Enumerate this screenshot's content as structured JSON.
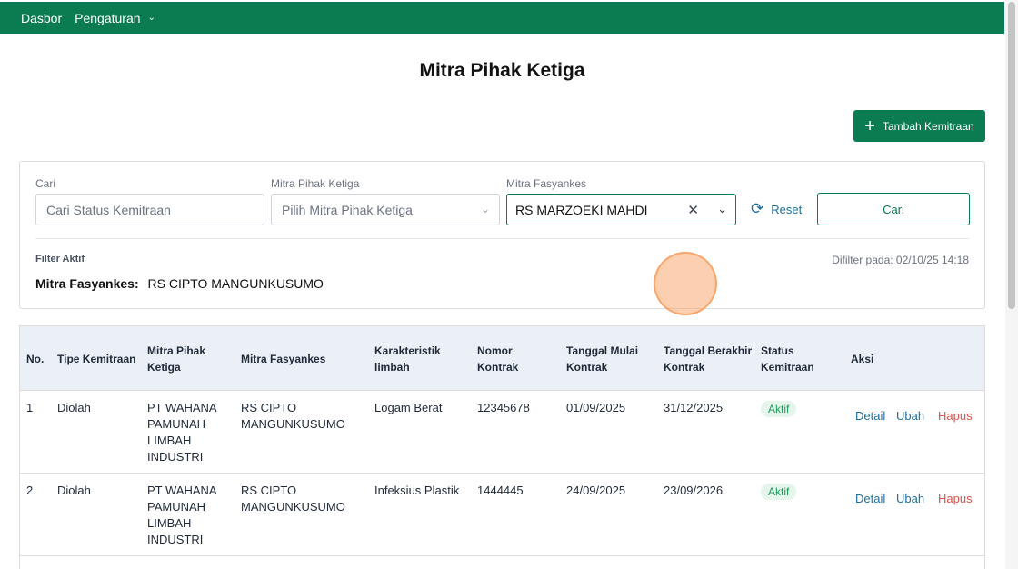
{
  "nav": {
    "items": [
      "Dasbor",
      "Pengaturan"
    ]
  },
  "page": {
    "title": "Mitra Pihak Ketiga",
    "add_button": "Tambah Kemitraan"
  },
  "filters": {
    "search": {
      "label": "Cari",
      "placeholder": "Cari Status Kemitraan"
    },
    "partner": {
      "label": "Mitra Pihak Ketiga",
      "placeholder": "Pilih Mitra Pihak Ketiga"
    },
    "facility": {
      "label": "Mitra Fasyankes",
      "value": "RS MARZOEKI MAHDI"
    },
    "reset_label": "Reset",
    "search_button": "Cari",
    "active_label": "Filter Aktif",
    "active_key": "Mitra Fasyankes:",
    "active_value": "RS CIPTO MANGUNKUSUMO",
    "filtered_at": "Difilter pada: 02/10/25 14:18"
  },
  "table": {
    "headers": {
      "no": "No.",
      "type": "Tipe Kemitraan",
      "partner": [
        "Mitra Pihak",
        "Ketiga"
      ],
      "facility": "Mitra Fasyankes",
      "waste": [
        "Karakteristik",
        "limbah"
      ],
      "contract": [
        "Nomor",
        "Kontrak"
      ],
      "start": [
        "Tanggal Mulai",
        "Kontrak"
      ],
      "end": [
        "Tanggal Berakhir",
        "Kontrak"
      ],
      "status": [
        "Status",
        "Kemitraan"
      ],
      "action": "Aksi"
    },
    "rows": [
      {
        "no": "1",
        "type": "Diolah",
        "partner": [
          "PT WAHANA",
          "PAMUNAH",
          "LIMBAH",
          "INDUSTRI"
        ],
        "facility": [
          "RS CIPTO",
          "MANGUNKUSUMO"
        ],
        "waste": "Logam Berat",
        "contract": "12345678",
        "start": "01/09/2025",
        "end": "31/12/2025",
        "status": "Aktif"
      },
      {
        "no": "2",
        "type": "Diolah",
        "partner": [
          "PT WAHANA",
          "PAMUNAH",
          "LIMBAH",
          "INDUSTRI"
        ],
        "facility": [
          "RS CIPTO",
          "MANGUNKUSUMO"
        ],
        "waste": "Infeksius Plastik",
        "contract": "1444445",
        "start": "24/09/2025",
        "end": "23/09/2026",
        "status": "Aktif"
      }
    ],
    "actions": {
      "detail": "Detail",
      "edit": "Ubah",
      "delete": "Hapus"
    }
  },
  "colors": {
    "brand": "#0b7b52",
    "link": "#1f6f9e",
    "danger": "#d9534f",
    "badge_bg": "#e6f5ec",
    "badge_text": "#1c9a58"
  }
}
